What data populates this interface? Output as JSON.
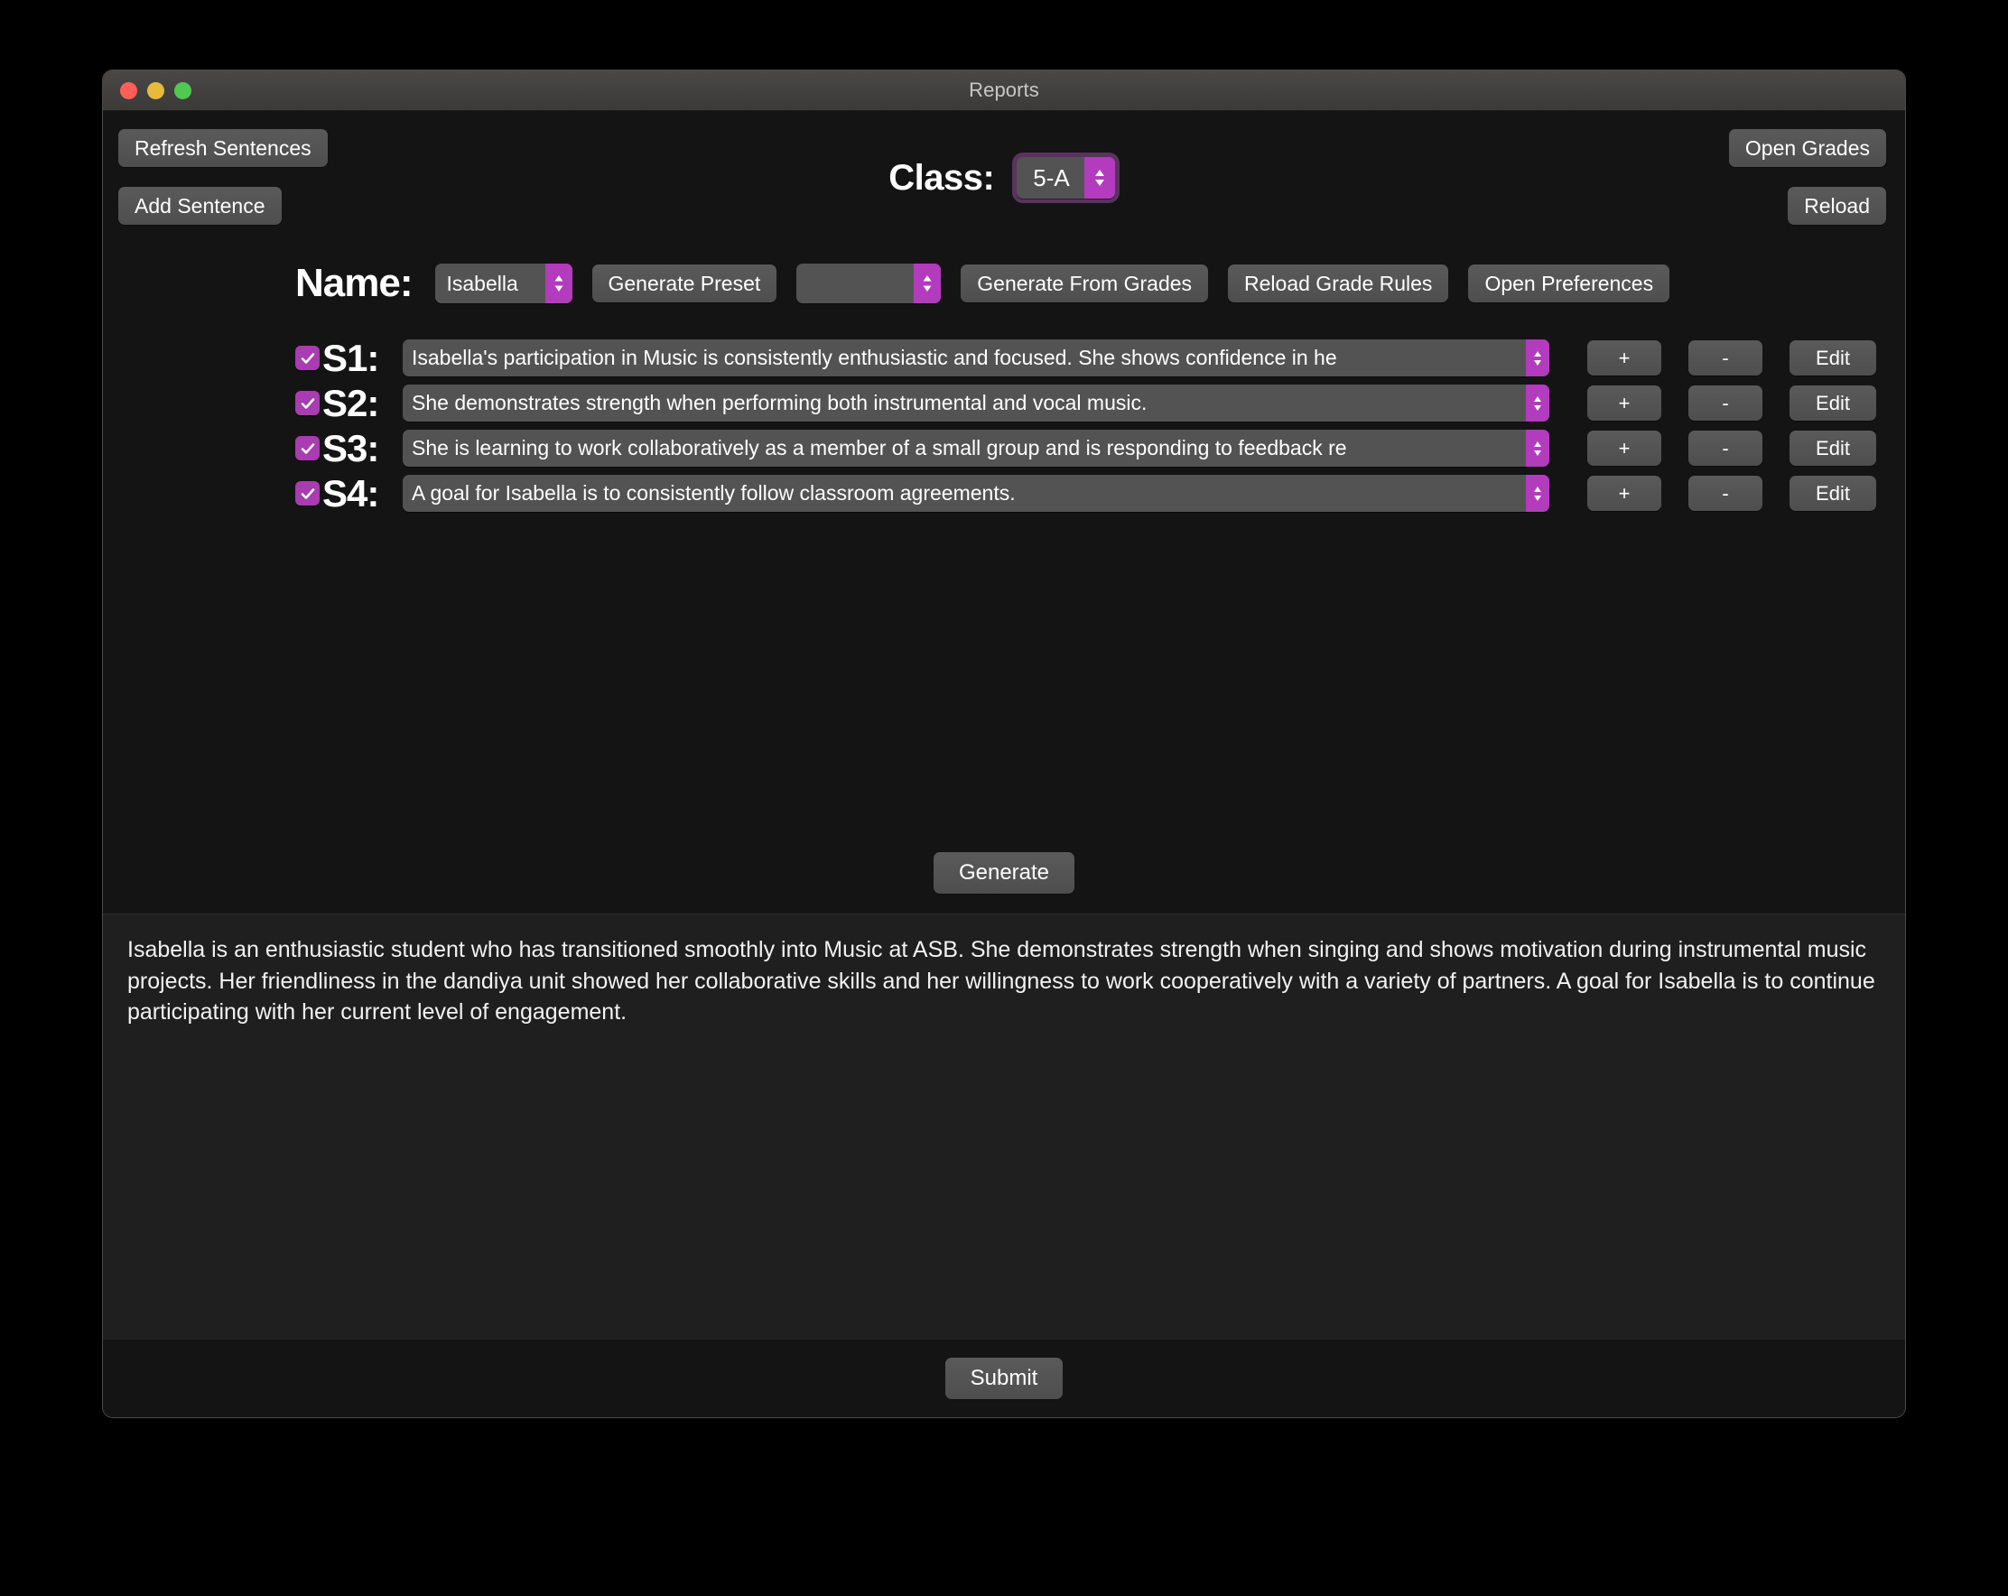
{
  "window": {
    "title": "Reports",
    "traffic_lights": [
      "close",
      "minimize",
      "maximize"
    ]
  },
  "toolbar": {
    "refresh_sentences_label": "Refresh Sentences",
    "add_sentence_label": "Add Sentence",
    "open_grades_label": "Open Grades",
    "reload_label": "Reload",
    "class_label": "Class:",
    "class_value": "5-A"
  },
  "name_row": {
    "name_label": "Name:",
    "name_value": "Isabella",
    "generate_preset_label": "Generate Preset",
    "preset_value": "",
    "generate_from_grades_label": "Generate From Grades",
    "reload_grade_rules_label": "Reload Grade Rules",
    "open_preferences_label": "Open Preferences"
  },
  "sentences": [
    {
      "id": "S1",
      "label": "S1:",
      "checked": true,
      "text": "Isabella's participation in Music is consistently enthusiastic and focused. She shows confidence in he",
      "add_label": "+",
      "remove_label": "-",
      "edit_label": "Edit"
    },
    {
      "id": "S2",
      "label": "S2:",
      "checked": true,
      "text": "She demonstrates strength when performing both instrumental and vocal music.",
      "add_label": "+",
      "remove_label": "-",
      "edit_label": "Edit"
    },
    {
      "id": "S3",
      "label": "S3:",
      "checked": true,
      "text": "She is learning to work collaboratively as a member of a small group and is responding to feedback re",
      "add_label": "+",
      "remove_label": "-",
      "edit_label": "Edit"
    },
    {
      "id": "S4",
      "label": "S4:",
      "checked": true,
      "text": "A goal for Isabella is to consistently follow classroom agreements.",
      "add_label": "+",
      "remove_label": "-",
      "edit_label": "Edit"
    }
  ],
  "actions": {
    "generate_label": "Generate",
    "submit_label": "Submit"
  },
  "output": {
    "text": "Isabella is an enthusiastic student who has transitioned smoothly into Music at ASB. She demonstrates strength when singing and shows motivation during instrumental music projects. Her friendliness in the dandiya unit showed her collaborative skills and her willingness to work cooperatively with a variety of partners. A goal for Isabella is to continue participating with her current level of engagement."
  },
  "colors": {
    "accent_purple": "#b33bbd",
    "checkbox_purple": "#a83cb0",
    "focus_ring": "#59335e",
    "window_bg": "#141414",
    "panel_bg": "#1f1f1f",
    "control_gray": "#535353"
  },
  "icons": {
    "stepper": "chevron-up-down-icon",
    "checkmark": "checkmark-icon"
  }
}
